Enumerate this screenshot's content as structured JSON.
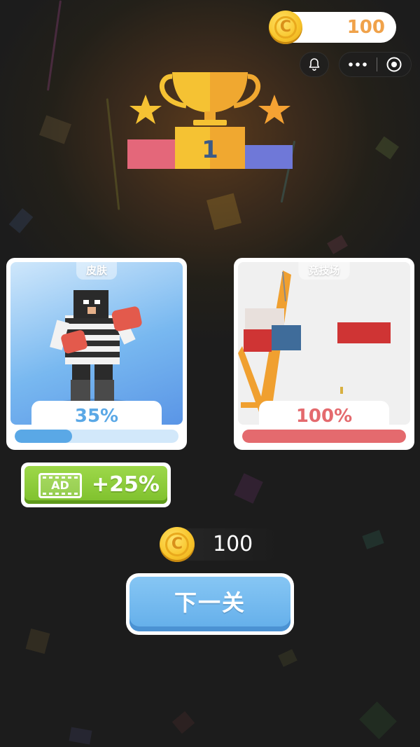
{
  "header": {
    "coin_icon_label": "C",
    "coin_balance": "100"
  },
  "capsule": {
    "bell_icon": "bell-icon",
    "more_icon": "more-dots-icon",
    "record_icon": "record-eye-icon"
  },
  "trophy": {
    "podium_rank": "1"
  },
  "cards": {
    "skin": {
      "tag": "皮肤",
      "percent_text": "35%",
      "progress": 0.35,
      "color": "#5aa8e6"
    },
    "arena": {
      "tag": "竞技场",
      "percent_text": "100%",
      "progress": 1.0,
      "color": "#e46a6e"
    }
  },
  "ad_button": {
    "ad_label": "AD",
    "bonus_label": "+25%"
  },
  "reward": {
    "coin_icon_label": "C",
    "amount": "100"
  },
  "next_button": {
    "label": "下一关"
  }
}
